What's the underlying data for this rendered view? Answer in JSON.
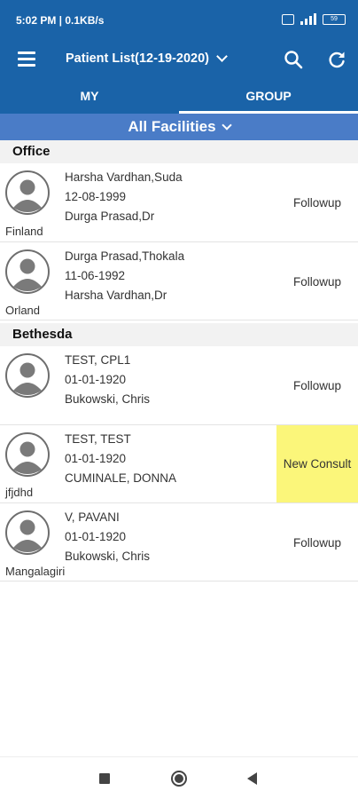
{
  "status_bar": {
    "time": "5:02 PM | 0.1KB/s",
    "battery": "59"
  },
  "header": {
    "title": "Patient List(12-19-2020)"
  },
  "tabs": [
    {
      "label": "MY"
    },
    {
      "label": "GROUP"
    }
  ],
  "facility_selector": {
    "label": "All Facilities"
  },
  "groups": [
    {
      "name": "Office",
      "patients": [
        {
          "name": "Harsha Vardhan,Suda",
          "dob": "12-08-1999",
          "doctor": "Durga Prasad,Dr",
          "location": "Finland",
          "status": "Followup"
        },
        {
          "name": "Durga Prasad,Thokala",
          "dob": "11-06-1992",
          "doctor": "Harsha Vardhan,Dr",
          "location": "Orland",
          "status": "Followup"
        }
      ]
    },
    {
      "name": "Bethesda",
      "patients": [
        {
          "name": "TEST, CPL1",
          "dob": "01-01-1920",
          "doctor": "Bukowski, Chris",
          "location": "",
          "status": "Followup"
        },
        {
          "name": "TEST, TEST",
          "dob": "01-01-1920",
          "doctor": "CUMINALE, DONNA",
          "location": "jfjdhd",
          "status": "New Consult",
          "status_color": "#fbf67a"
        },
        {
          "name": "V, PAVANI",
          "dob": "01-01-1920",
          "doctor": "Bukowski, Chris",
          "location": "Mangalagiri",
          "status": "Followup"
        }
      ]
    }
  ],
  "colors": {
    "app_bar": "#1a63a8",
    "facility_bar": "#4a7cc7",
    "new_consult_highlight": "#fbf67a"
  }
}
